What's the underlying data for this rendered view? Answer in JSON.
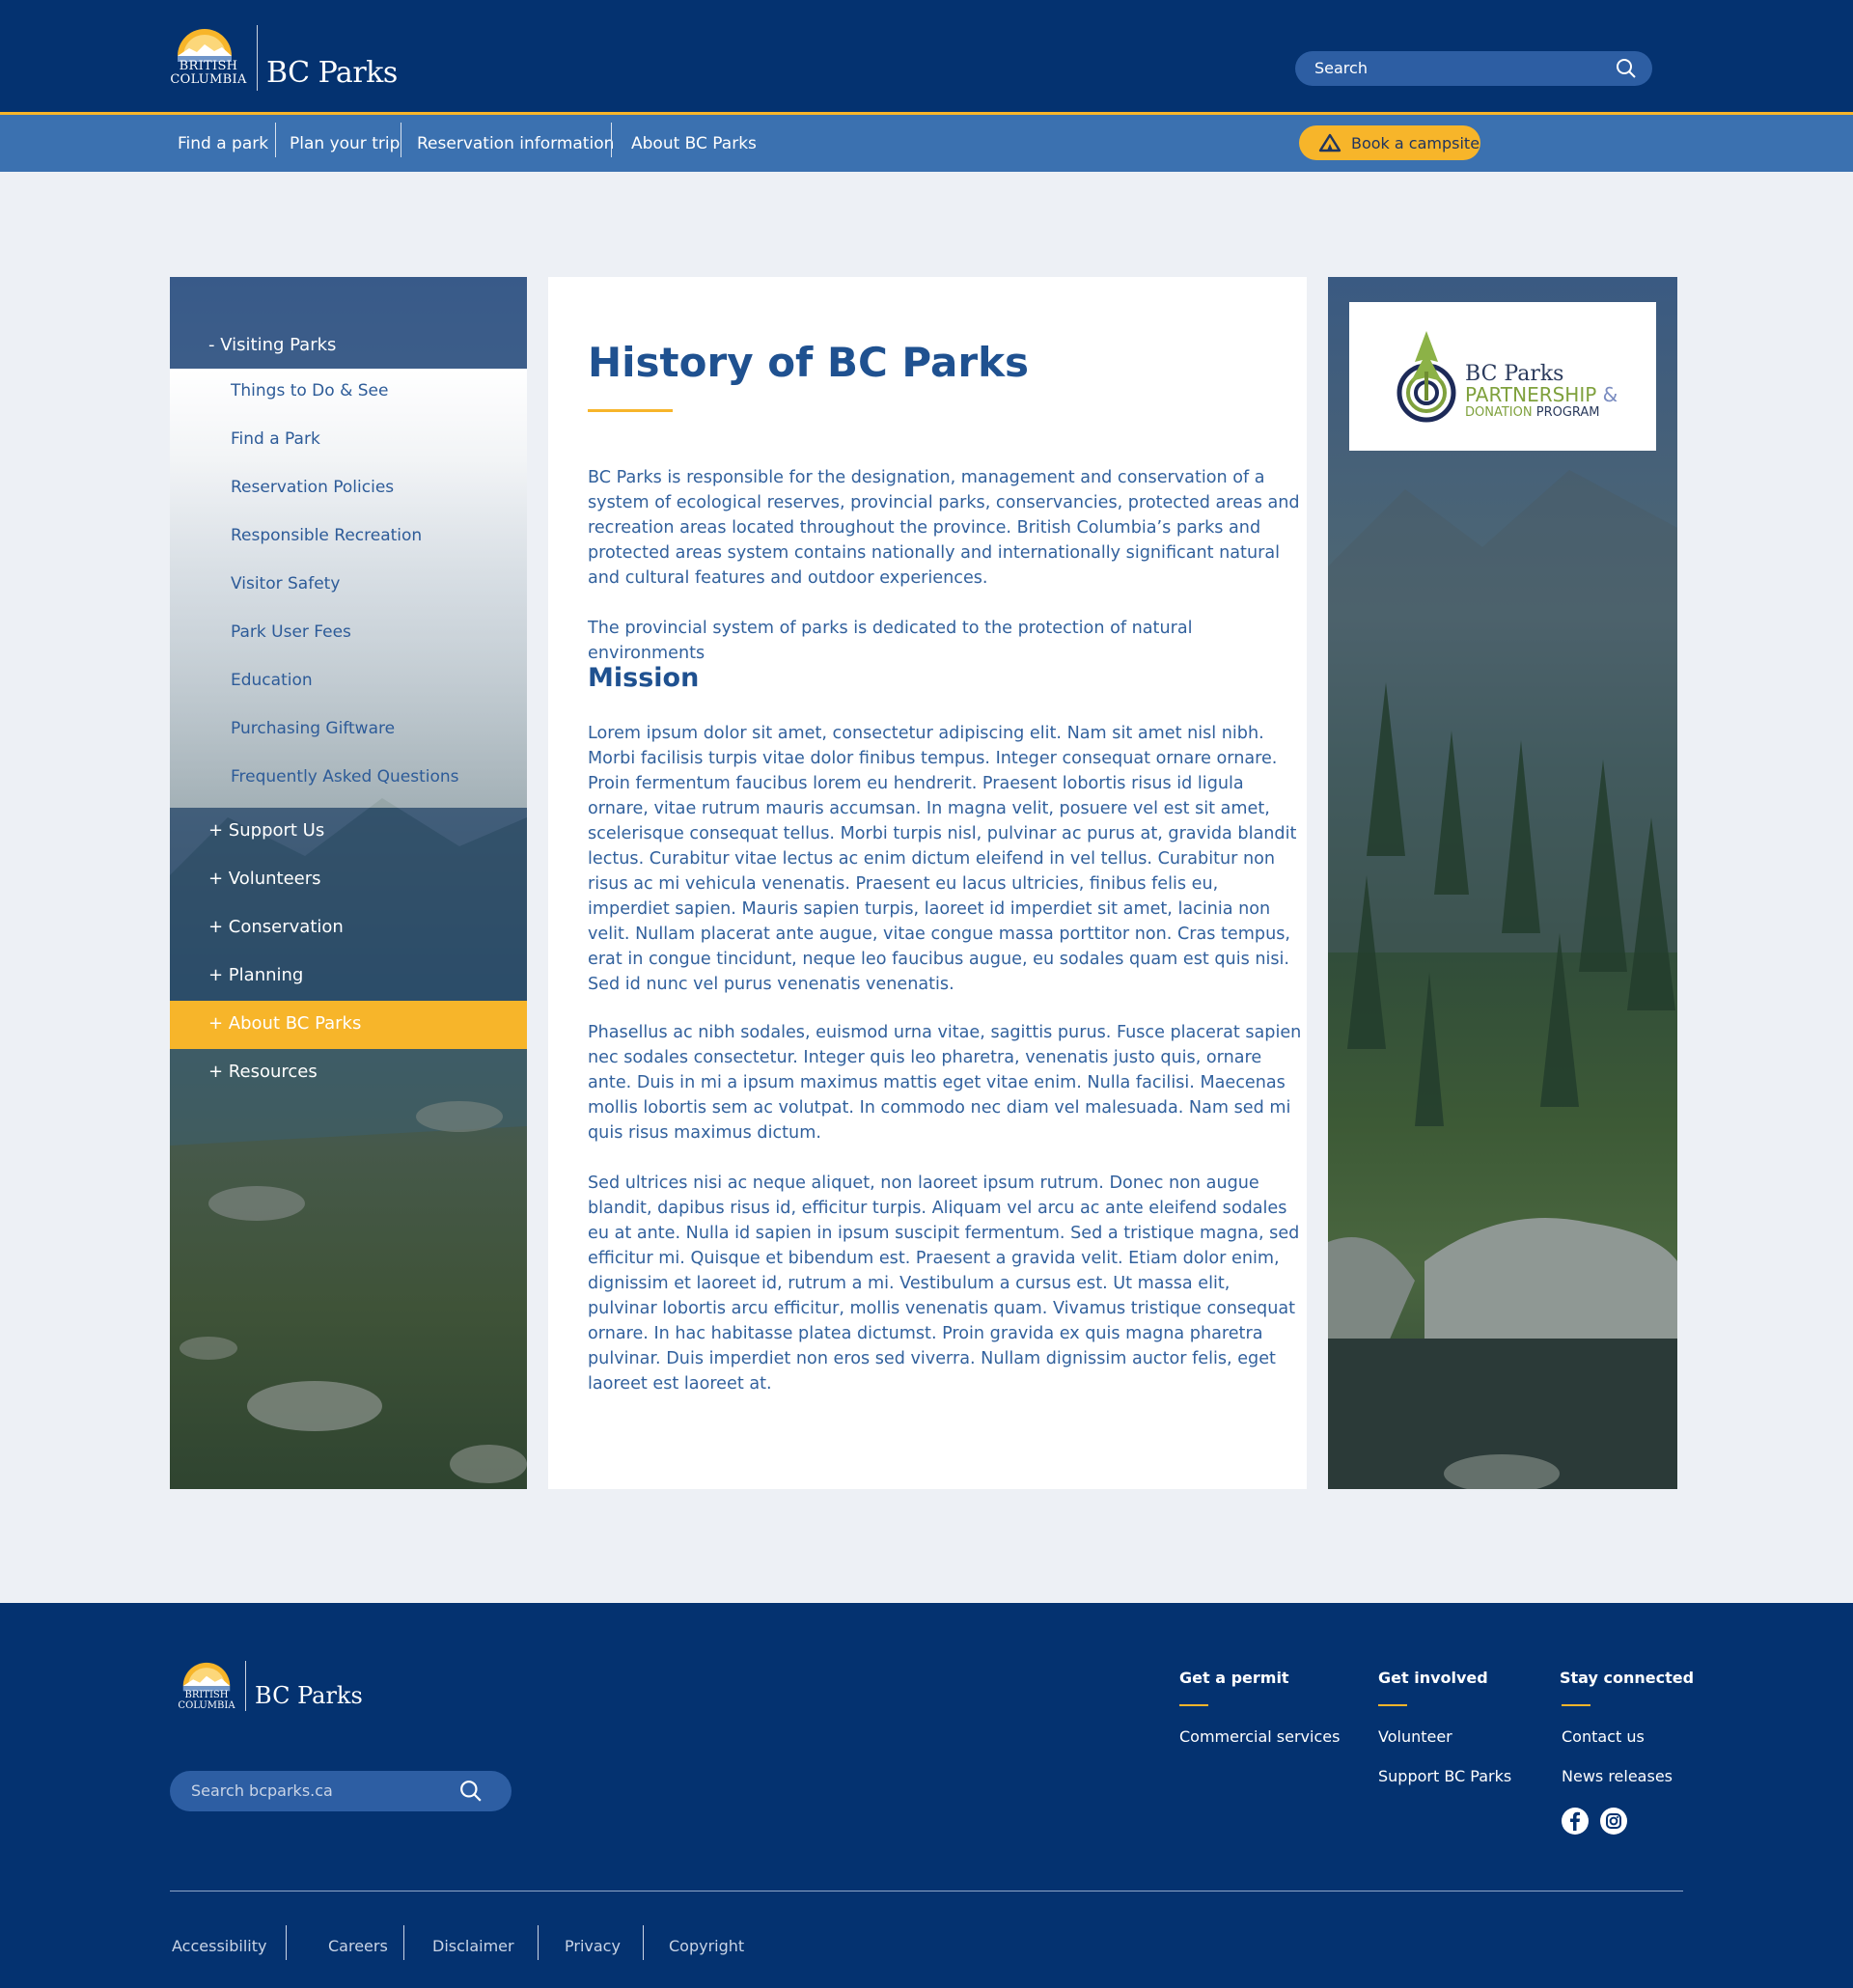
{
  "header": {
    "logo": {
      "province_line1": "BRITISH",
      "province_line2": "COLUMBIA",
      "brand": "BC Parks"
    },
    "search": {
      "placeholder": "Search",
      "icon": "search-icon"
    }
  },
  "nav": {
    "items": [
      {
        "label": "Find a park"
      },
      {
        "label": "Plan your trip"
      },
      {
        "label": "Reservation information"
      },
      {
        "label": "About BC Parks"
      }
    ],
    "book_button": {
      "label": "Book a campsite",
      "icon": "tent-icon"
    }
  },
  "sidebar": {
    "active_section": "- Visiting Parks",
    "sub_items": [
      {
        "label": "Things to Do & See"
      },
      {
        "label": "Find a Park"
      },
      {
        "label": "Reservation Policies"
      },
      {
        "label": "Responsible Recreation"
      },
      {
        "label": "Visitor Safety"
      },
      {
        "label": "Park User Fees"
      },
      {
        "label": "Education"
      },
      {
        "label": "Purchasing Giftware"
      },
      {
        "label": "Frequently Asked Questions"
      }
    ],
    "main_items": [
      {
        "label": "+  Support Us"
      },
      {
        "label": "+  Volunteers"
      },
      {
        "label": "+  Conservation"
      },
      {
        "label": "+  Planning"
      },
      {
        "label": "+  About BC Parks"
      },
      {
        "label": "+  Resources"
      }
    ],
    "active_main": "About BC Parks"
  },
  "content": {
    "title": "History of BC Parks",
    "intro": [
      "BC Parks is responsible for the designation, management and conservation of a system of ecological reserves, provincial parks, conservancies, protected areas and recreation areas located throughout the province. British Columbia’s parks and protected areas system contains nationally and internationally significant natural and cultural features and outdoor experiences.",
      "The provincial system of parks is dedicated to the protection of natural environments"
    ],
    "mission_heading": "Mission",
    "mission_paragraphs": [
      "Lorem ipsum dolor sit amet, consectetur adipiscing elit. Nam sit amet nisl nibh. Morbi facilisis turpis vitae dolor finibus tempus. Integer consequat ornare ornare. Proin fermentum faucibus lorem eu hendrerit. Praesent lobortis risus id ligula ornare, vitae rutrum mauris accumsan. In magna velit, posuere vel est sit amet, scelerisque consequat tellus. Morbi turpis nisl, pulvinar ac purus at, gravida blandit lectus. Curabitur vitae lectus ac enim dictum eleifend in vel tellus. Curabitur non risus ac mi vehicula venenatis. Praesent eu lacus ultricies, finibus felis eu, imperdiet sapien. Mauris sapien turpis, laoreet id imperdiet sit amet, lacinia non velit. Nullam placerat ante augue, vitae congue massa porttitor non. Cras tempus, erat in congue tincidunt, neque leo faucibus augue, eu sodales quam est quis nisi. Sed id nunc vel purus venenatis venenatis.",
      "Phasellus ac nibh sodales, euismod urna vitae, sagittis purus. Fusce placerat sapien nec sodales consectetur. Integer quis leo pharetra, venenatis justo quis, ornare ante. Duis in mi a ipsum maximus mattis eget vitae enim. Nulla facilisi. Maecenas mollis lobortis sem ac volutpat. In commodo nec diam vel malesuada. Nam sed mi quis risus maximus dictum.",
      "Sed ultrices nisi ac neque aliquet, non laoreet ipsum rutrum. Donec non augue blandit, dapibus risus id, efficitur turpis. Aliquam vel arcu ac ante eleifend sodales eu at ante. Nulla id sapien in ipsum suscipit fermentum. Sed a tristique magna, sed efficitur mi. Quisque et bibendum est. Praesent a gravida velit. Etiam dolor enim, dignissim et laoreet id, rutrum a mi. Vestibulum a cursus est. Ut massa elit, pulvinar lobortis arcu efficitur, mollis venenatis quam. Vivamus tristique consequat ornare. In hac habitasse platea dictumst. Proin gravida ex quis magna pharetra pulvinar. Duis imperdiet non eros sed viverra. Nullam dignissim auctor felis, eget laoreet est laoreet at."
    ]
  },
  "partner": {
    "line1": "BC Parks",
    "line2": "PARTNERSHIP",
    "amp": "&",
    "line3a": "DONATION",
    "line3b": "PROGRAM"
  },
  "footer": {
    "logo": {
      "province_line1": "BRITISH",
      "province_line2": "COLUMBIA",
      "brand": "BC Parks"
    },
    "search": {
      "placeholder": "Search bcparks.ca",
      "icon": "search-icon"
    },
    "columns": [
      {
        "heading": "Get a permit",
        "links": [
          "Commercial services"
        ]
      },
      {
        "heading": "Get involved",
        "links": [
          "Volunteer",
          "Support BC Parks"
        ]
      },
      {
        "heading": "Stay connected",
        "links": [
          "Contact us",
          "News releases"
        ]
      }
    ],
    "social": [
      "facebook-icon",
      "instagram-icon"
    ],
    "bottom_links": [
      "Accessibility",
      "Careers",
      "Disclaimer",
      "Privacy",
      "Copyright"
    ]
  },
  "colors": {
    "header_bg": "#043270",
    "nav_bg": "#3b71b0",
    "accent": "#f7b52a",
    "heading": "#1f5190",
    "page_bg": "#edf0f5"
  }
}
